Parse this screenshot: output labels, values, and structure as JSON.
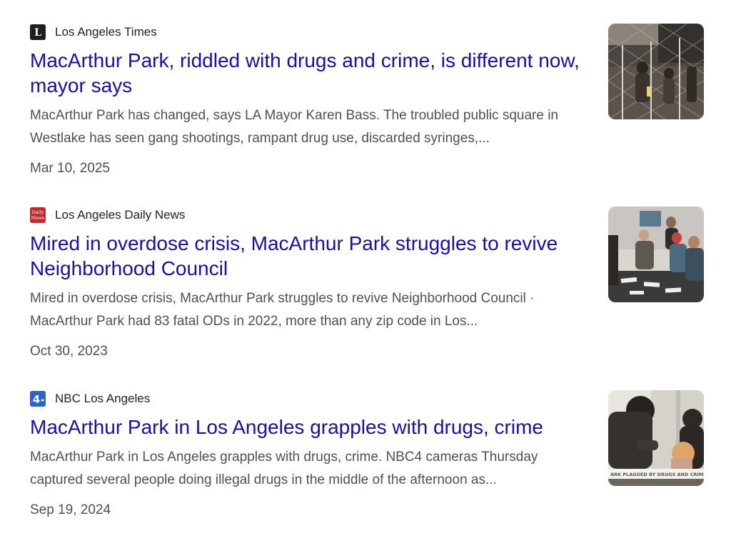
{
  "results": [
    {
      "source": "Los Angeles Times",
      "title": "MacArthur Park, riddled with drugs and crime, is different now, mayor says",
      "snippet": "MacArthur Park has changed, says LA Mayor Karen Bass. The troubled public square in Westlake has seen gang shootings, rampant drug use, discarded syringes,...",
      "date": "Mar 10, 2025",
      "favicon": "la-times-logo-icon",
      "favicon_color": "#1f1f1f"
    },
    {
      "source": "Los Angeles Daily News",
      "title": "Mired in overdose crisis, MacArthur Park struggles to revive Neighborhood Council",
      "snippet": "Mired in overdose crisis, MacArthur Park struggles to revive Neighborhood Council · MacArthur Park had 83 fatal ODs in 2022, more than any zip code in Los...",
      "date": "Oct 30, 2023",
      "favicon": "daily-news-logo-icon",
      "favicon_color": "#c8262d"
    },
    {
      "source": "NBC Los Angeles",
      "title": "MacArthur Park in Los Angeles grapples with drugs, crime",
      "snippet": "MacArthur Park in Los Angeles grapples with drugs, crime. NBC4 cameras Thursday captured several people doing illegal drugs in the middle of the afternoon as...",
      "date": "Sep 19, 2024",
      "favicon": "nbc4-logo-icon",
      "favicon_color": "#2b63c6",
      "thumb_caption": "ARK PLAGUED BY DRUGS AND CRIME"
    }
  ],
  "favicon_text": {
    "latimes": "L",
    "dailynews_top": "Daily",
    "dailynews_bottom": "News",
    "nbc": "4"
  },
  "colors": {
    "title_link": "#1a0dab",
    "snippet_text": "#4d5156",
    "source_text": "#202124"
  }
}
